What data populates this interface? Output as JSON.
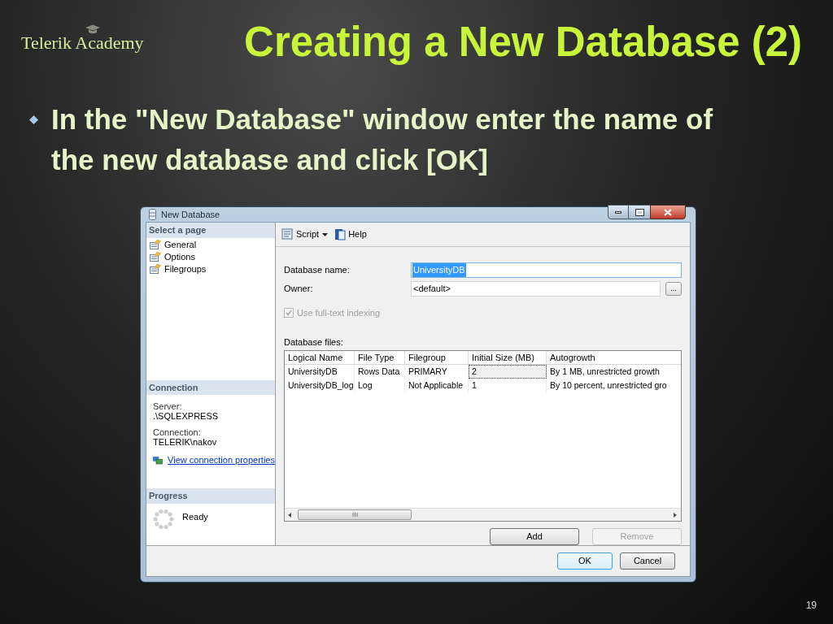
{
  "slide": {
    "logo": "Telerik Academy",
    "title": "Creating a New Database (2)",
    "bullets": [
      "In the \"New Database\" window enter the name of the new database and click [OK]"
    ],
    "page_number": "19"
  },
  "window": {
    "title": "New Database"
  },
  "sidebar": {
    "pages_header": "Select a page",
    "pages": [
      {
        "label": "General"
      },
      {
        "label": "Options"
      },
      {
        "label": "Filegroups"
      }
    ],
    "connection_header": "Connection",
    "connection": [
      {
        "label": "Server:",
        "value": ".\\SQLEXPRESS"
      },
      {
        "label": "Connection:",
        "value": "TELERIK\\nakov"
      }
    ],
    "connection_link": "View connection properties",
    "progress_header": "Progress",
    "progress_status": "Ready"
  },
  "toolbar": {
    "script": "Script",
    "help": "Help"
  },
  "form": {
    "database_name_label": "Database name:",
    "database_name": "UniversityDB",
    "owner_label": "Owner:",
    "owner": "<default>",
    "browse_button": "...",
    "fulltext": {
      "label": "Use full-text indexing",
      "checked": true,
      "disabled": true
    }
  },
  "files": {
    "label": "Database files:",
    "columns": [
      "Logical Name",
      "File Type",
      "Filegroup",
      "Initial Size (MB)",
      "Autogrowth"
    ],
    "rows": [
      {
        "cells": [
          "UniversityDB",
          "Rows Data",
          "PRIMARY",
          "2",
          "By 1 MB, unrestricted growth"
        ],
        "selected": true
      },
      {
        "cells": [
          "UniversityDB_log",
          "Log",
          "Not Applicable",
          "1",
          "By 10 percent, unrestricted gro"
        ],
        "selected": false
      }
    ]
  },
  "buttons": {
    "add": {
      "label": "Add",
      "disabled": false
    },
    "remove": {
      "label": "Remove",
      "disabled": true
    },
    "ok": "OK",
    "cancel": "Cancel"
  }
}
